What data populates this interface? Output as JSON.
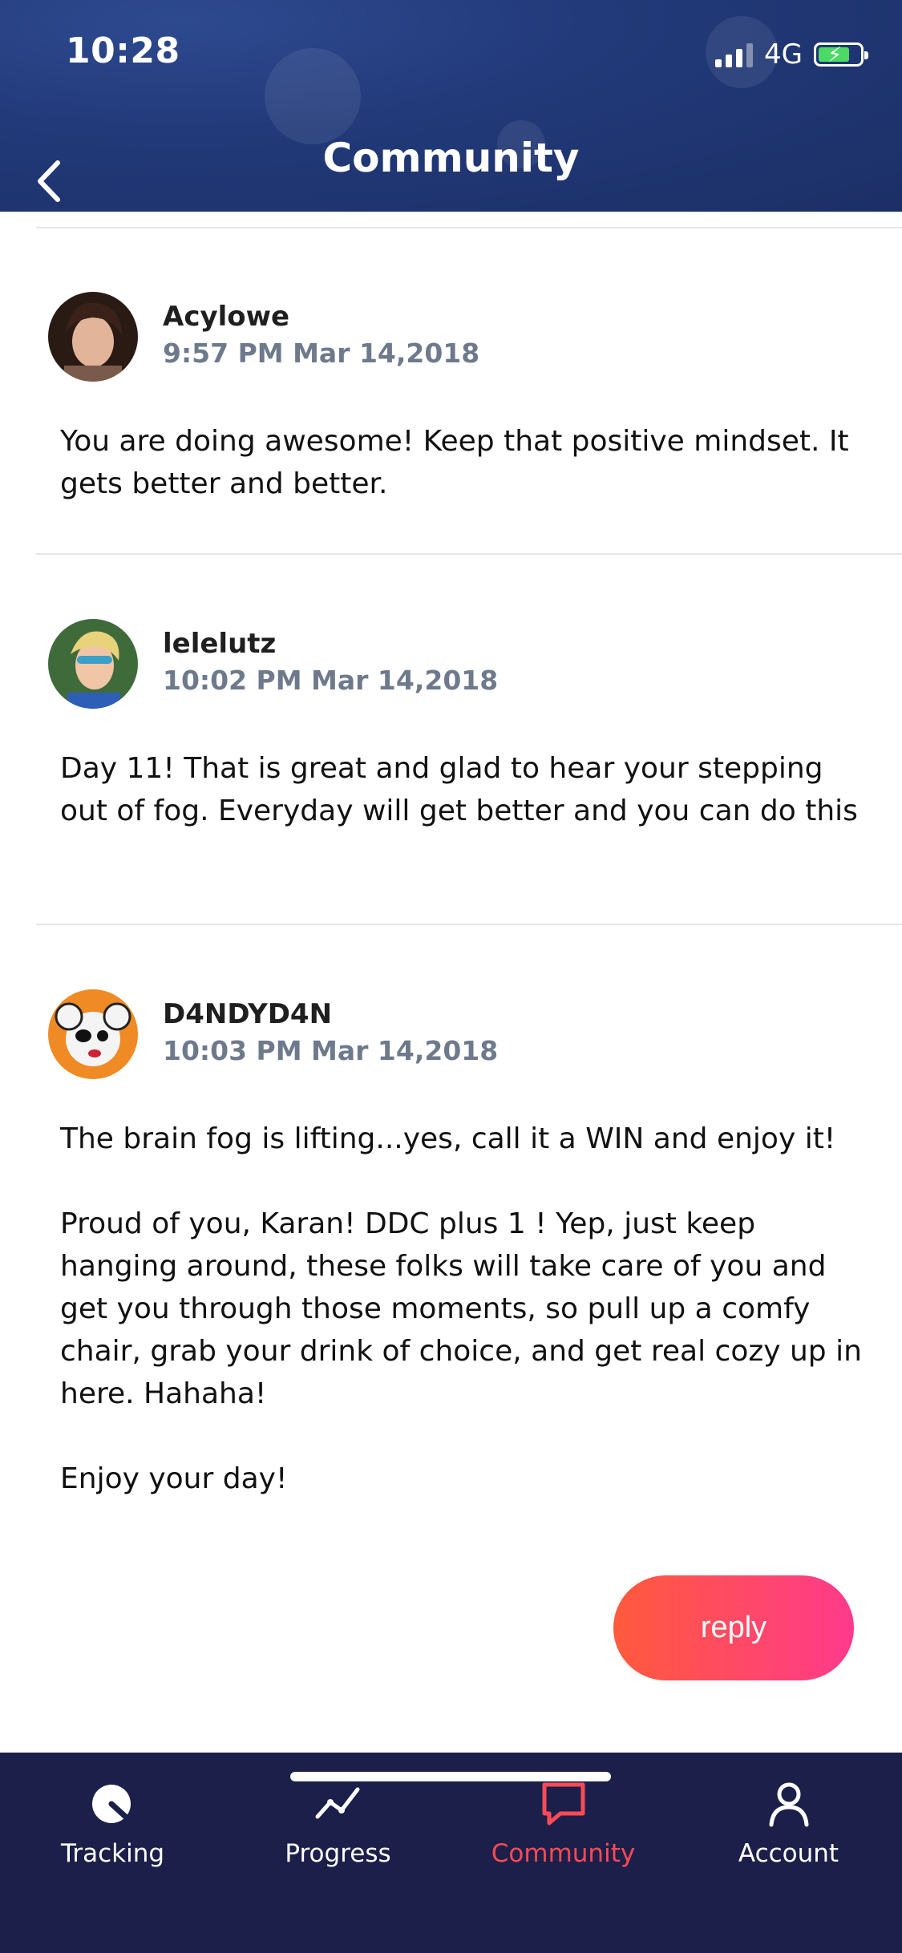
{
  "status": {
    "time": "10:28",
    "network": "4G"
  },
  "header": {
    "title": "Community"
  },
  "posts": [
    {
      "username": "Acylowe",
      "timestamp": "9:57 PM Mar 14,2018",
      "text": "You are doing awesome! Keep that positive mindset. It gets better and better."
    },
    {
      "username": "lelelutz",
      "timestamp": "10:02 PM Mar 14,2018",
      "text": "Day 11! That is great and glad to hear your stepping out of fog. Everyday will get better and you can do this"
    },
    {
      "username": "D4NDYD4N",
      "timestamp": "10:03 PM Mar 14,2018",
      "text": "The brain fog is lifting...yes, call it a WIN and enjoy it!\n\nProud of you, Karan! DDC plus 1 ! Yep, just keep hanging around, these folks will take care of you and get you through those moments, so pull up a comfy chair, grab your drink of choice, and get real cozy up in here. Hahaha!\n\nEnjoy your day!"
    }
  ],
  "reply_label": "reply",
  "tabs": [
    {
      "label": "Tracking",
      "icon": "tracking-icon"
    },
    {
      "label": "Progress",
      "icon": "progress-icon"
    },
    {
      "label": "Community",
      "icon": "community-icon",
      "active": true
    },
    {
      "label": "Account",
      "icon": "account-icon"
    }
  ],
  "colors": {
    "accent": "#ff4a55",
    "header": "#223a7a",
    "tabbar": "#1b1f4a"
  }
}
